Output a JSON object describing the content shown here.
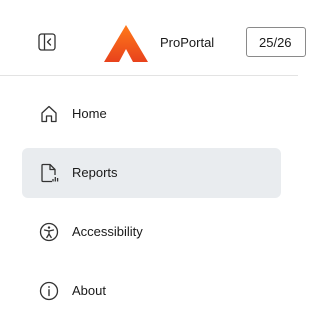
{
  "header": {
    "app_name": "ProPortal",
    "year_value": "25/26",
    "brand_color": "#f15a22"
  },
  "nav": {
    "items": [
      {
        "label": "Home",
        "icon": "home-icon",
        "active": false
      },
      {
        "label": "Reports",
        "icon": "reports-icon",
        "active": true
      },
      {
        "label": "Accessibility",
        "icon": "accessibility-icon",
        "active": false
      },
      {
        "label": "About",
        "icon": "info-icon",
        "active": false
      }
    ]
  }
}
